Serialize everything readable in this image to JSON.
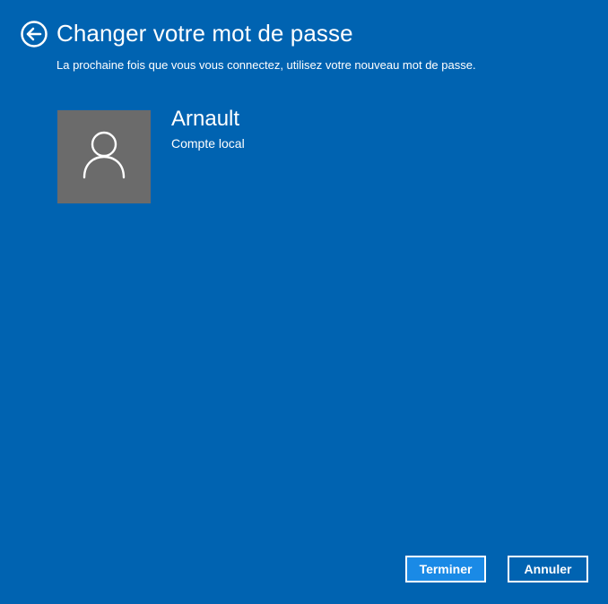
{
  "header": {
    "title": "Changer votre mot de passe",
    "subtitle": "La prochaine fois que vous vous connectez, utilisez votre nouveau mot de passe.",
    "back_icon": "back-arrow-circle-icon"
  },
  "user": {
    "name": "Arnault",
    "account_type": "Compte local",
    "avatar_icon": "user-silhouette-icon",
    "avatar_color": "#6b6b6b"
  },
  "buttons": {
    "finish_label": "Terminer",
    "cancel_label": "Annuler"
  },
  "colors": {
    "background": "#0063b1",
    "primary_button": "#1a8ae6",
    "text": "#ffffff"
  }
}
